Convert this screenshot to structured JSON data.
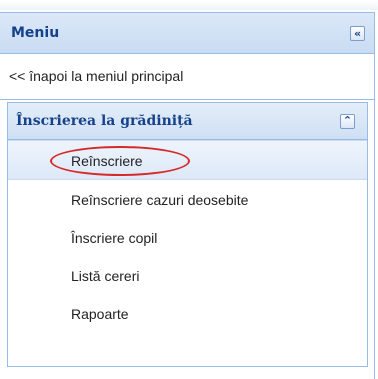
{
  "menu_panel": {
    "title": "Meniu",
    "collapse_glyph": "«",
    "back_link": "<< înapoi la meniul principal"
  },
  "subpanel": {
    "title": "Înscrierea la grădiniță",
    "collapse_glyph": "⌃",
    "items": [
      {
        "label": "Reînscriere",
        "selected": true
      },
      {
        "label": "Reînscriere cazuri deosebite",
        "selected": false
      },
      {
        "label": "Înscriere copil",
        "selected": false
      },
      {
        "label": "Listă cereri",
        "selected": false
      },
      {
        "label": "Rapoarte",
        "selected": false
      }
    ]
  },
  "colors": {
    "header_text": "#15428b",
    "border": "#99bbe8",
    "annotation": "#d62a2a"
  }
}
